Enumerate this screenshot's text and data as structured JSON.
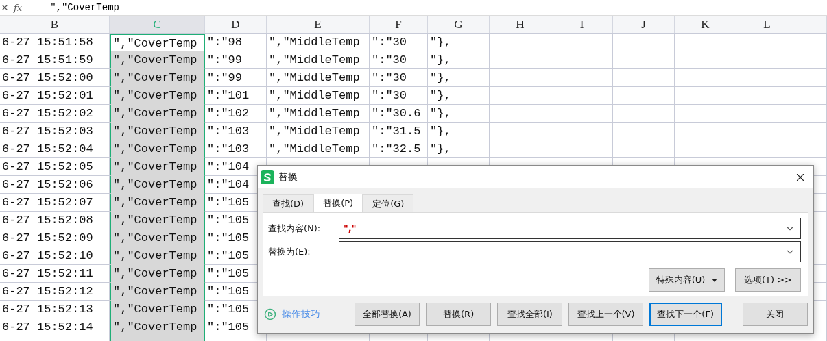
{
  "formula_bar": {
    "label": "fx",
    "value": "\",\"CoverTemp"
  },
  "columns": [
    {
      "label": "B",
      "selected": false
    },
    {
      "label": "C",
      "selected": true
    },
    {
      "label": "D",
      "selected": false
    },
    {
      "label": "E",
      "selected": false
    },
    {
      "label": "F",
      "selected": false
    },
    {
      "label": "G",
      "selected": false
    },
    {
      "label": "H",
      "selected": false
    },
    {
      "label": "I",
      "selected": false
    },
    {
      "label": "J",
      "selected": false
    },
    {
      "label": "K",
      "selected": false
    },
    {
      "label": "L",
      "selected": false
    }
  ],
  "rows": [
    {
      "active": true,
      "cells": [
        "6-27 15:51:58",
        "\",\"CoverTemp",
        "\":\"98",
        "\",\"MiddleTemp",
        "\":\"30",
        "\"},"
      ]
    },
    {
      "active": false,
      "cells": [
        "6-27 15:51:59",
        "\",\"CoverTemp",
        "\":\"99",
        "\",\"MiddleTemp",
        "\":\"30",
        "\"},"
      ]
    },
    {
      "active": false,
      "cells": [
        "6-27 15:52:00",
        "\",\"CoverTemp",
        "\":\"99",
        "\",\"MiddleTemp",
        "\":\"30",
        "\"},"
      ]
    },
    {
      "active": false,
      "cells": [
        "6-27 15:52:01",
        "\",\"CoverTemp",
        "\":\"101",
        "\",\"MiddleTemp",
        "\":\"30",
        "\"},"
      ]
    },
    {
      "active": false,
      "cells": [
        "6-27 15:52:02",
        "\",\"CoverTemp",
        "\":\"102",
        "\",\"MiddleTemp",
        "\":\"30.6",
        "\"},"
      ]
    },
    {
      "active": false,
      "cells": [
        "6-27 15:52:03",
        "\",\"CoverTemp",
        "\":\"103",
        "\",\"MiddleTemp",
        "\":\"31.5",
        "\"},"
      ]
    },
    {
      "active": false,
      "cells": [
        "6-27 15:52:04",
        "\",\"CoverTemp",
        "\":\"103",
        "\",\"MiddleTemp",
        "\":\"32.5",
        "\"},"
      ]
    },
    {
      "active": false,
      "cells": [
        "6-27 15:52:05",
        "\",\"CoverTemp",
        "\":\"104"
      ]
    },
    {
      "active": false,
      "cells": [
        "6-27 15:52:06",
        "\",\"CoverTemp",
        "\":\"104"
      ]
    },
    {
      "active": false,
      "cells": [
        "6-27 15:52:07",
        "\",\"CoverTemp",
        "\":\"105"
      ]
    },
    {
      "active": false,
      "cells": [
        "6-27 15:52:08",
        "\",\"CoverTemp",
        "\":\"105"
      ]
    },
    {
      "active": false,
      "cells": [
        "6-27 15:52:09",
        "\",\"CoverTemp",
        "\":\"105"
      ]
    },
    {
      "active": false,
      "cells": [
        "6-27 15:52:10",
        "\",\"CoverTemp",
        "\":\"105"
      ]
    },
    {
      "active": false,
      "cells": [
        "6-27 15:52:11",
        "\",\"CoverTemp",
        "\":\"105"
      ]
    },
    {
      "active": false,
      "cells": [
        "6-27 15:52:12",
        "\",\"CoverTemp",
        "\":\"105"
      ]
    },
    {
      "active": false,
      "cells": [
        "6-27 15:52:13",
        "\",\"CoverTemp",
        "\":\"105"
      ]
    },
    {
      "active": false,
      "cells": [
        "6-27 15:52:14",
        "\",\"CoverTemp",
        "\":\"105"
      ]
    }
  ],
  "dialog": {
    "title": "替换",
    "tabs": [
      {
        "label": "查找(D)",
        "selected": false
      },
      {
        "label": "替换(P)",
        "selected": true
      },
      {
        "label": "定位(G)",
        "selected": false
      }
    ],
    "fields": [
      {
        "label": "查找内容(N):",
        "value": "\",\"",
        "focused": false
      },
      {
        "label": "替换为(E):",
        "focused": true
      }
    ],
    "special_button": "特殊内容(U)",
    "options_button": "选项(T) >>",
    "tips_link": "操作技巧",
    "buttons": [
      {
        "label": "全部替换(A)",
        "focused": false
      },
      {
        "label": "替换(R)",
        "focused": false
      },
      {
        "label": "查找全部(I)",
        "focused": false
      },
      {
        "label": "查找上一个(V)",
        "focused": false
      },
      {
        "label": "查找下一个(F)",
        "focused": true
      },
      {
        "label": "关闭",
        "focused": false
      }
    ]
  }
}
